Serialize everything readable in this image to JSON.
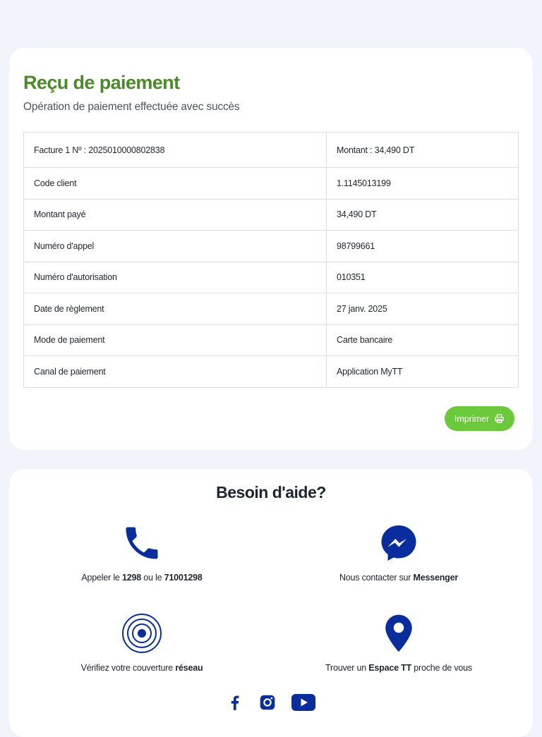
{
  "receipt": {
    "title": "Reçu de paiement",
    "subtitle": "Opération de paiement effectuée avec succès",
    "rows": [
      {
        "label": "Facture 1 Nº : 2025010000802838",
        "value": "Montant : 34,490 DT"
      },
      {
        "label": "Code client",
        "value": "1.1145013199"
      },
      {
        "label": "Montant payé",
        "value": "34,490 DT"
      },
      {
        "label": "Numéro d'appel",
        "value": "98799661"
      },
      {
        "label": "Numéro d'autorisation",
        "value": "010351"
      },
      {
        "label": "Date de règlement",
        "value": "27 janv. 2025"
      },
      {
        "label": "Mode de paiement",
        "value": "Carte bancaire"
      },
      {
        "label": "Canal de paiement",
        "value": "Application MyTT"
      }
    ],
    "print_label": "Imprimer",
    "print_icon": "printer-icon"
  },
  "help": {
    "title": "Besoin d'aide?",
    "call": {
      "icon": "phone-icon",
      "prefix": "Appeler le ",
      "number1": "1298",
      "middle": " ou le ",
      "number2": "71001298"
    },
    "messenger": {
      "icon": "messenger-icon",
      "prefix": "Nous contacter sur ",
      "bold": "Messenger"
    },
    "coverage": {
      "icon": "network-coverage-icon",
      "prefix": "Vérifiez votre couverture ",
      "bold": "réseau"
    },
    "shop": {
      "icon": "location-pin-icon",
      "prefix": "Trouver un ",
      "bold": "Espace TT",
      "suffix": " proche de vous"
    },
    "social": [
      "facebook-icon",
      "instagram-icon",
      "youtube-icon"
    ]
  },
  "colors": {
    "background": "#f1f4fb",
    "title_green": "#4a8a28",
    "button_green": "#6cc93b",
    "icon_blue": "#0a2d9e"
  }
}
